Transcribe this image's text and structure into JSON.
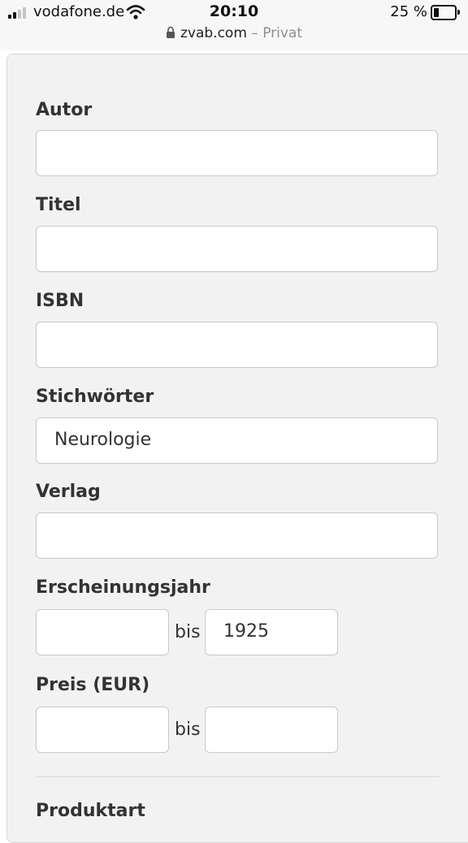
{
  "status_bar": {
    "carrier": "vodafone.de",
    "time": "20:10",
    "battery_text": "25 %",
    "battery_level": 0.25,
    "icons": [
      "signal-icon",
      "wifi-icon",
      "battery-icon",
      "lock-icon"
    ]
  },
  "browser": {
    "domain": "zvab.com",
    "mode": "– Privat"
  },
  "form": {
    "autor": {
      "label": "Autor",
      "value": ""
    },
    "titel": {
      "label": "Titel",
      "value": ""
    },
    "isbn": {
      "label": "ISBN",
      "value": ""
    },
    "stichwoerter": {
      "label": "Stichwörter",
      "value": "Neurologie"
    },
    "verlag": {
      "label": "Verlag",
      "value": ""
    },
    "erscheinungsjahr": {
      "label": "Erscheinungsjahr",
      "from": "",
      "bis": "bis",
      "to": "1925"
    },
    "preis": {
      "label": "Preis (EUR)",
      "from": "",
      "bis": "bis",
      "to": ""
    },
    "produktart": {
      "label": "Produktart"
    }
  }
}
